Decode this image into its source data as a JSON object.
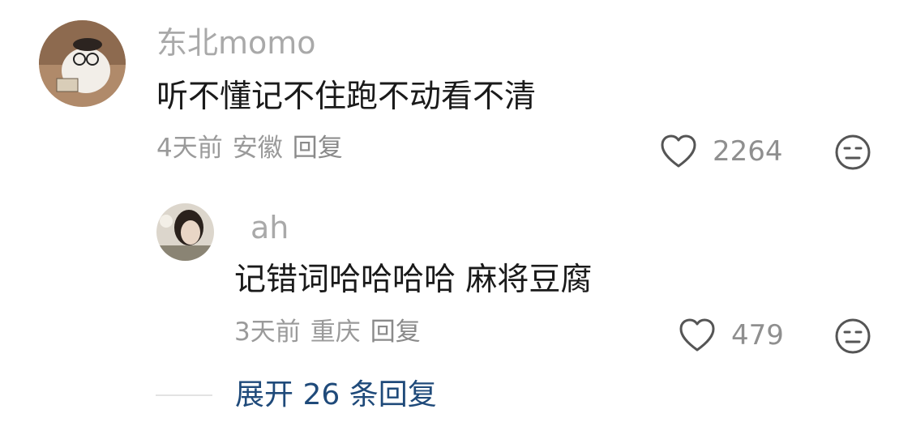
{
  "comments": [
    {
      "username": "东北momo",
      "text": "听不懂记不住跑不动看不清",
      "time": "4天前",
      "location": "安徽",
      "reply_label": "回复",
      "likes": "2264",
      "like_icon": "heart-outline-icon",
      "dislike_icon": "neutral-face-icon"
    }
  ],
  "replies": [
    {
      "username": "ah",
      "text": "记错词哈哈哈哈 麻将豆腐",
      "time": "3天前",
      "location": "重庆",
      "reply_label": "回复",
      "likes": "479",
      "like_icon": "heart-outline-icon",
      "dislike_icon": "neutral-face-icon"
    }
  ],
  "expand_replies_label": "展开 26 条回复",
  "colors": {
    "username": "#a9a9a9",
    "text": "#1a1a1a",
    "meta": "#9a9a9a",
    "expand_link": "#1f4a7a"
  }
}
